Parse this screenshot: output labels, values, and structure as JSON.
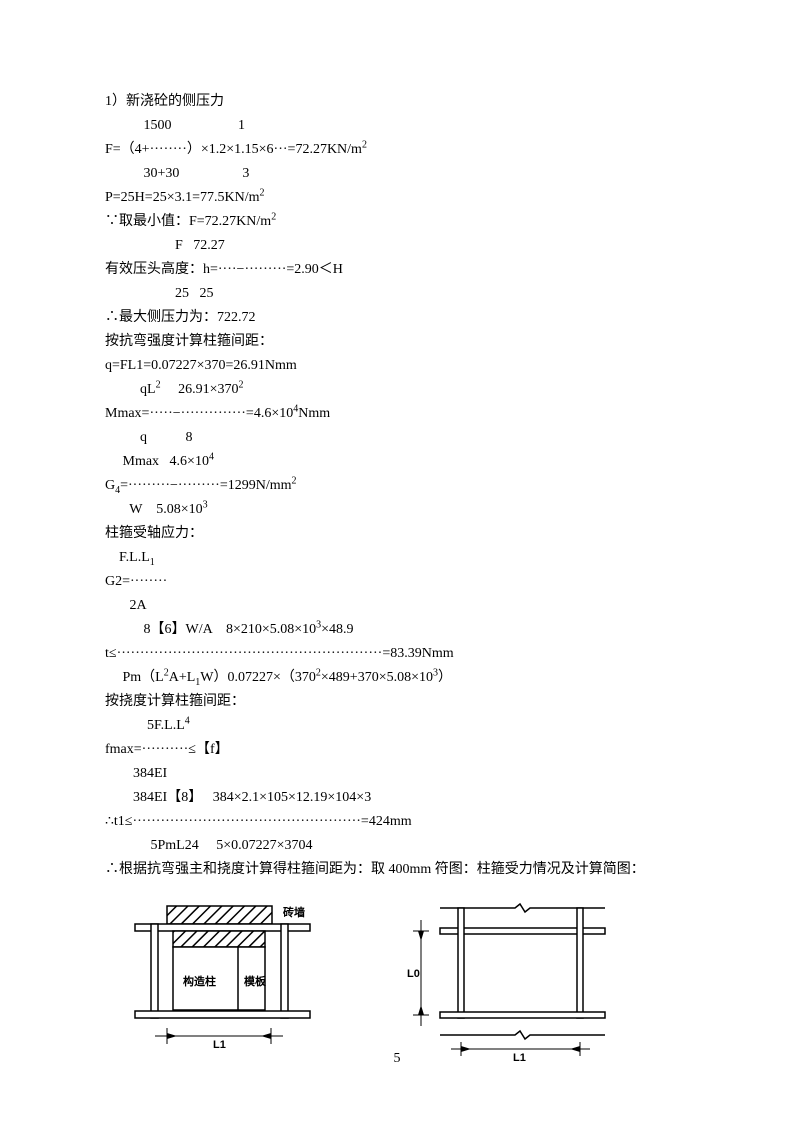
{
  "title": "1）新浇砼的侧压力",
  "lines": {
    "l1": "           1500                   1",
    "l2_a": "F=（4+········）×1.2×1.15×6···=72.27KN/m",
    "l3": "           30+30                  3",
    "l4_a": "P=25H=25×3.1=77.5KN/m",
    "l5_a": "∵取最小值：F=72.27KN/m",
    "l6": "                    F   72.27",
    "l7": "有效压头高度：h=····−·········=2.90＜H",
    "l8": "                    25   25",
    "l9": "∴最大侧压力为：722.72",
    "l10": "按抗弯强度计算柱箍间距：",
    "l11": "q=FL1=0.07227×370=26.91Nmm",
    "l12_a": "          qL",
    "l12_b": "     26.91×370",
    "l13_a": "Mmax=·····−··············=4.6×10",
    "l13_b": "Nmm",
    "l14": "          q           8",
    "l15_a": "     Mmax   4.6×10",
    "l16_a": "G",
    "l16_b": "=·········−·········=1299N/mm",
    "l17_a": "       W    5.08×10",
    "l18": "柱箍受轴应力：",
    "l19_a": "    F.L.L",
    "l20": "G2=········",
    "l21": "       2A",
    "l22_a": "           8【6】W/A    8×210×5.08×10",
    "l22_b": "×48.9",
    "l23": "t≤·························································=83.39Nmm",
    "l24_a": "     Pm（L",
    "l24_b": "A+L",
    "l24_c": "W）0.07227×（370",
    "l24_d": "×489+370×5.08×10",
    "l24_e": "）",
    "l25": "按挠度计算柱箍间距：",
    "l26_a": "            5F.L.L",
    "l27": "fmax=··········≤【f】",
    "l28": "        384EI",
    "l29": "        384EI【8】   384×2.1×105×12.19×104×3",
    "l30": "∴t1≤·················································=424mm",
    "l31": "             5PmL24     5×0.07227×3704",
    "l32": "∴根据抗弯强主和挠度计算得柱箍间距为：取 400mm 符图：柱箍受力情况及计算简图："
  },
  "figure": {
    "label_brick": "砖墙",
    "label_gouzao": "构造柱",
    "label_muban": "模板",
    "label_L1": "L1",
    "label_L0": "L0"
  },
  "pageNumber": "5"
}
